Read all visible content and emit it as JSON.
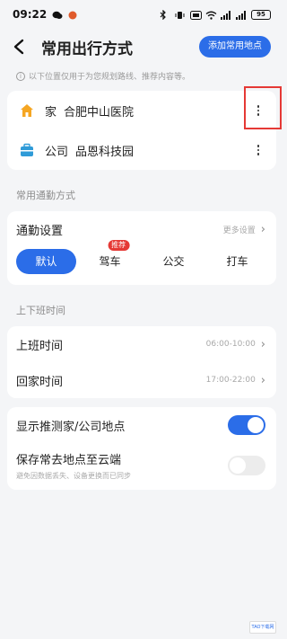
{
  "status_bar": {
    "time": "09:22",
    "battery": "95"
  },
  "header": {
    "title": "常用出行方式",
    "add_place_label": "添加常用地点"
  },
  "info": {
    "text": "以下位置仅用于为您规划路线、推荐内容等。"
  },
  "places": [
    {
      "type": "家",
      "name": "合肥中山医院",
      "icon": "home-icon"
    },
    {
      "type": "公司",
      "name": "品恩科技园",
      "icon": "company-icon"
    }
  ],
  "commute": {
    "section_label": "常用通勤方式",
    "setting_label": "通勤设置",
    "more_label": "更多设置",
    "modes": [
      {
        "label": "默认",
        "active": true
      },
      {
        "label": "驾车",
        "active": false,
        "badge": "推荐"
      },
      {
        "label": "公交",
        "active": false
      },
      {
        "label": "打车",
        "active": false
      }
    ]
  },
  "work_time": {
    "section_label": "上下班时间",
    "rows": [
      {
        "label": "上班时间",
        "value": "06:00-10:00"
      },
      {
        "label": "回家时间",
        "value": "17:00-22:00"
      }
    ]
  },
  "toggles": {
    "show_guess": {
      "label": "显示推测家/公司地点",
      "on": true
    },
    "cloud_save": {
      "label": "保存常去地点至云端",
      "sub": "避免因数据丢失、设备更换而已同步",
      "on": false
    }
  },
  "watermark": "TAO下载网",
  "colors": {
    "accent": "#2b6de8",
    "badge": "#e53935",
    "highlight": "#e53935"
  }
}
